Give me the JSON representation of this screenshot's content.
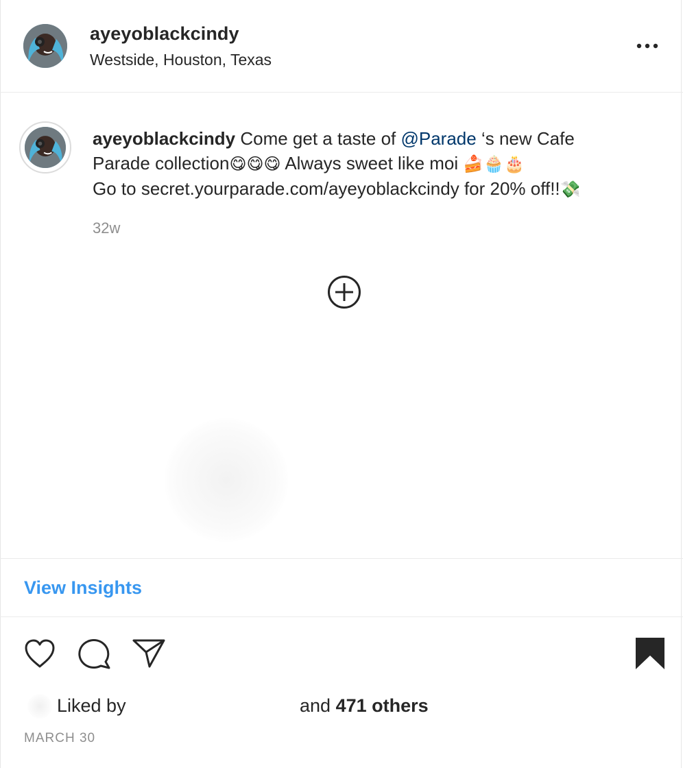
{
  "header": {
    "username": "ayeyoblackcindy",
    "location": "Westside, Houston, Texas",
    "more_icon": "more-horizontal-icon"
  },
  "caption": {
    "username": "ayeyoblackcindy",
    "text_part1": " Come get a taste of ",
    "mention": "@Parade",
    "text_part2": " ‘s new Cafe",
    "line2_text": "Parade collection",
    "line2_emojis": "😋😋😋",
    "line2_text_b": " Always sweet like moi ",
    "line2_emojis_b": "🍰🧁🎂",
    "line3_text": "Go to secret.yourparade.com/ayeyoblackcindy for 20% off!!",
    "line3_emoji": "💸"
  },
  "timestamp": "32w",
  "insights": {
    "label": "View Insights"
  },
  "actions": {
    "like_icon": "heart-icon",
    "comment_icon": "comment-icon",
    "share_icon": "paper-plane-icon",
    "save_icon": "bookmark-icon"
  },
  "likes": {
    "liked_by": "Liked by",
    "and": "and ",
    "count": "471 others"
  },
  "date": "MARCH 30",
  "colors": {
    "link": "#3897f0",
    "mention": "#00376b",
    "muted": "#8e8e8e",
    "text": "#262626"
  }
}
